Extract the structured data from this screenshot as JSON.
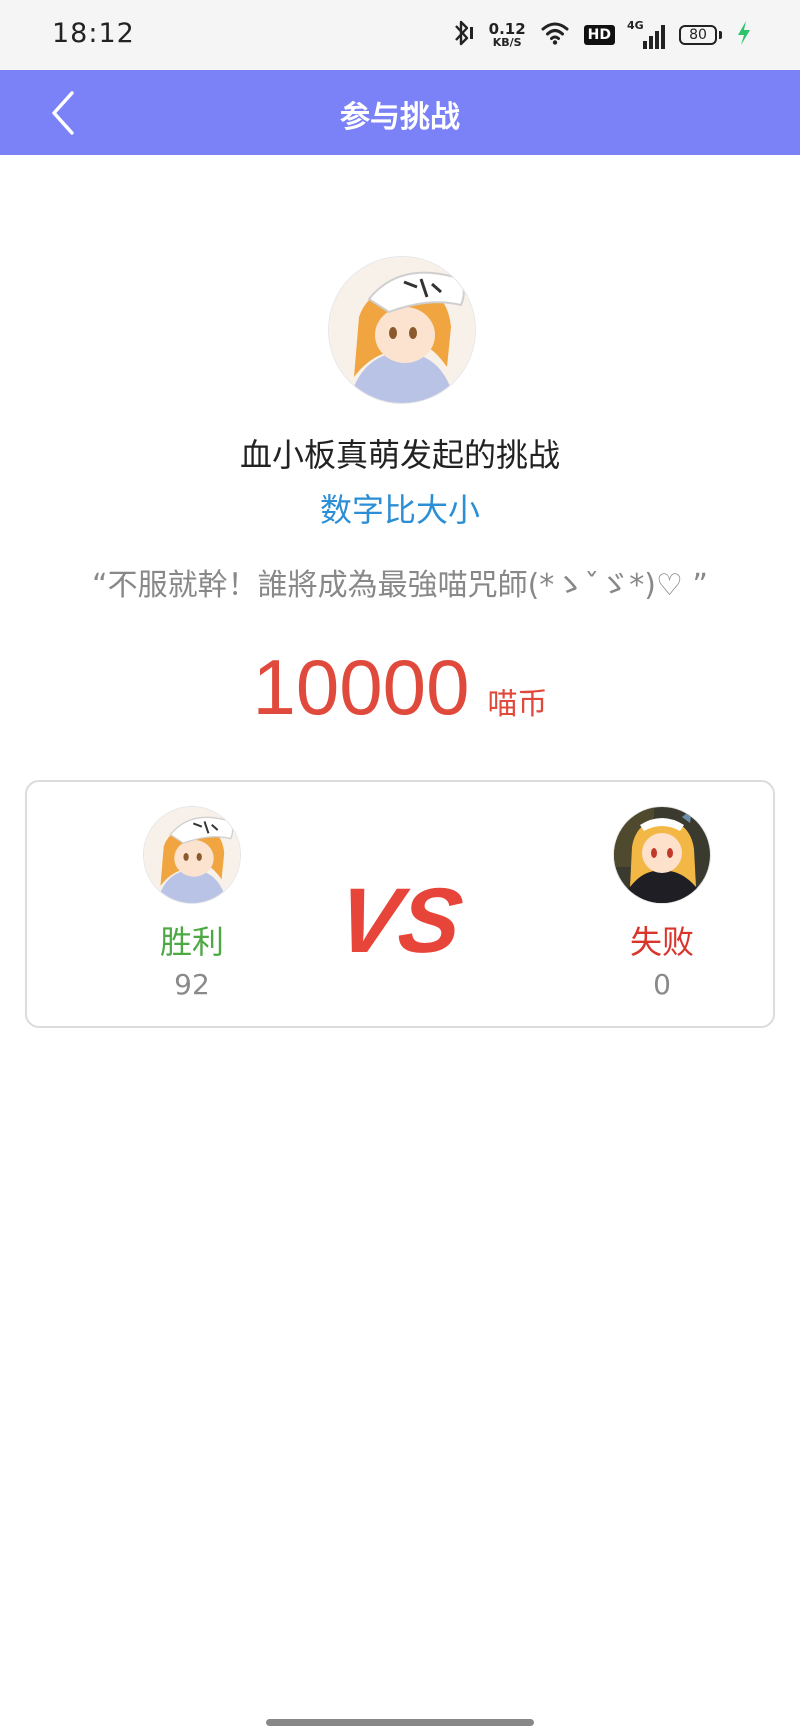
{
  "status_bar": {
    "time": "18:12",
    "net_speed_value": "0.12",
    "net_speed_unit": "KB/S",
    "hd_badge": "HD",
    "network_type": "4G",
    "battery_level": "80",
    "icons": [
      "bluetooth-icon",
      "wifi-icon",
      "signal-icon",
      "battery-icon",
      "charging-icon"
    ]
  },
  "header": {
    "title": "参与挑战",
    "back_icon": "chevron-left-icon",
    "background_color": "#7b82f7"
  },
  "challenge": {
    "challenger_line": "血小板真萌发起的挑战",
    "game_type": "数字比大小",
    "slogan": "“不服就幹！誰將成為最強喵咒師(*ゝˇゞ*)♡ ”",
    "stake_amount": "10000",
    "stake_unit": "喵币",
    "accent_color": "#e04a3c",
    "link_color": "#2c8fd6"
  },
  "versus": {
    "vs_label": "VS",
    "left_player": {
      "result": "胜利",
      "score": "92",
      "result_color": "#4ca944"
    },
    "right_player": {
      "result": "失败",
      "score": "0",
      "result_color": "#d9352b"
    }
  }
}
